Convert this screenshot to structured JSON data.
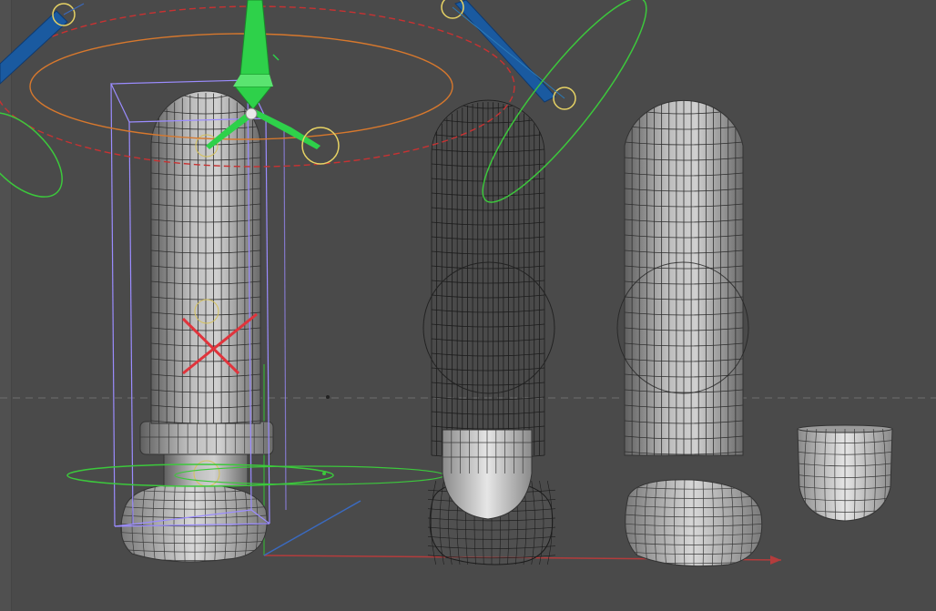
{
  "viewport": {
    "background": "#4a4a4a",
    "floor_line_color": "#7a7a7a",
    "axis_colors": {
      "x_axis": "#c04040",
      "y_axis": "#3a9a3a",
      "z_axis": "#3a6ac0"
    },
    "objects": [
      {
        "name": "capsule-with-base-selected",
        "state": "selected-solid"
      },
      {
        "name": "capsule-wireframe-with-cup",
        "state": "wireframe"
      },
      {
        "name": "capsule-plain",
        "state": "solid"
      },
      {
        "name": "base-stone",
        "state": "solid"
      },
      {
        "name": "cup-bowl",
        "state": "solid"
      }
    ],
    "gizmo": {
      "move_arrow_color": "#2ed14a",
      "rotate_ring_red": "#c83232",
      "rotate_ring_orange": "#d7782d",
      "rotate_ring_green": "#3cc83c",
      "handle_ring": "#e6d264",
      "bounding_box": "#9b8cff",
      "center_mark": "#e0343c",
      "blue_cone": "#1a5aa0"
    }
  }
}
